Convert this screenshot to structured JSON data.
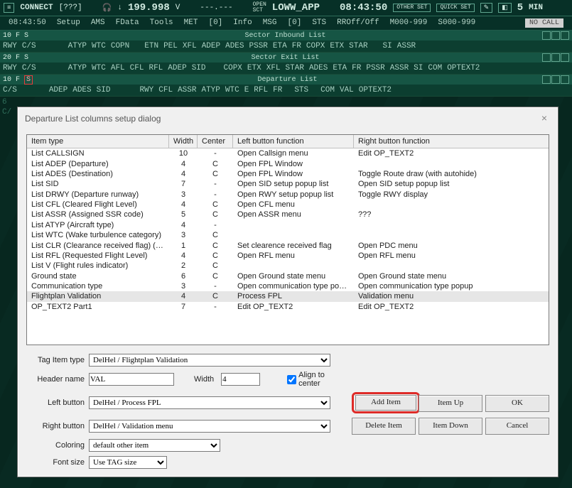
{
  "top": {
    "menu_word": "MENU",
    "connect": "CONNECT",
    "connect_state": "[???]",
    "headset": "🎧",
    "down_arrow": "↓",
    "freq": "199.998",
    "freq_v": "V",
    "dashes": "---.---",
    "open_lbl": "OPEN",
    "sct_lbl": "SCT",
    "sector": "LOWW_APP",
    "clock": "08:43:50",
    "other_set": "OTHER SET",
    "quick_set": "QUICK SET",
    "digit": "5",
    "min": "MIN"
  },
  "menubar": {
    "time": "08:43:50",
    "items": [
      "Setup",
      "AMS",
      "FData",
      "Tools",
      "MET",
      "[0]",
      "Info",
      "MSG",
      "[0]",
      "STS",
      "RROff/Off",
      "M000-999",
      "S000-999"
    ],
    "nocall": "NO CALL"
  },
  "lists": {
    "inbound": {
      "tag": "10 F  S",
      "title": "Sector Inbound List",
      "cols": [
        "RWY",
        "C/S",
        "ATYP",
        "WTC",
        "COPN",
        "ETN",
        "PEL",
        "XFL",
        "ADEP",
        "ADES",
        "PSSR",
        "ETA",
        "FR",
        "COPX",
        "ETX",
        "STAR",
        "SI",
        "ASSR"
      ]
    },
    "exit": {
      "tag": "20 F  S",
      "title": "Sector Exit List",
      "cols": [
        "RWY",
        "C/S",
        "ATYP",
        "WTC",
        "AFL",
        "CFL",
        "RFL",
        "ADEP",
        "SID",
        "COPX",
        "ETX",
        "XFL",
        "STAR",
        "ADES",
        "ETA",
        "FR",
        "PSSR",
        "ASSR",
        "SI",
        "COM",
        "OPTEXT2"
      ]
    },
    "dep": {
      "tag": "10 F",
      "tag_s": "S",
      "title": "Departure List",
      "cols": [
        "C/S",
        "ADEP",
        "ADES",
        "SID",
        "RWY",
        "CFL",
        "ASSR",
        "ATYP",
        "WTC",
        "E",
        "RFL",
        "FR",
        "STS",
        "COM",
        "VAL",
        "OPTEXT2"
      ]
    }
  },
  "bg": {
    "label1": "6",
    "label2": "C/"
  },
  "dialog": {
    "title": "Departure List columns setup dialog",
    "headers": {
      "c0": "Item type",
      "c1": "Width",
      "c2": "Center",
      "c3": "Left button function",
      "c4": "Right button function"
    },
    "rows": [
      {
        "t": "List CALLSIGN",
        "w": "10",
        "c": "-",
        "l": "Open Callsign menu",
        "r": "Edit OP_TEXT2"
      },
      {
        "t": "List ADEP (Departure)",
        "w": "4",
        "c": "C",
        "l": "Open FPL Window",
        "r": ""
      },
      {
        "t": "List ADES (Destination)",
        "w": "4",
        "c": "C",
        "l": "Open FPL Window",
        "r": "Toggle Route draw (with autohide)"
      },
      {
        "t": "List SID",
        "w": "7",
        "c": "-",
        "l": "Open SID setup popup list",
        "r": "Open SID setup popup list"
      },
      {
        "t": "List DRWY (Departure runway)",
        "w": "3",
        "c": "-",
        "l": "Open RWY setup popup list",
        "r": "Toggle RWY display"
      },
      {
        "t": "List CFL (Cleared Flight Level)",
        "w": "4",
        "c": "C",
        "l": "Open CFL menu",
        "r": ""
      },
      {
        "t": "List ASSR (Assigned SSR code)",
        "w": "5",
        "c": "C",
        "l": "Open ASSR menu",
        "r": "???"
      },
      {
        "t": "List ATYP (Aircraft type)",
        "w": "4",
        "c": "-",
        "l": "",
        "r": ""
      },
      {
        "t": "List WTC (Wake turbulence category)",
        "w": "3",
        "c": "C",
        "l": "",
        "r": ""
      },
      {
        "t": "List CLR (Clearance received flag) (short)",
        "w": "1",
        "c": "C",
        "l": "Set clearence received flag",
        "r": "Open PDC menu"
      },
      {
        "t": "List RFL (Requested Flight Level)",
        "w": "4",
        "c": "C",
        "l": "Open RFL menu",
        "r": "Open RFL menu"
      },
      {
        "t": "List V (Flight rules indicator)",
        "w": "2",
        "c": "C",
        "l": "",
        "r": ""
      },
      {
        "t": "Ground state",
        "w": "6",
        "c": "C",
        "l": "Open Ground state menu",
        "r": "Open Ground state menu"
      },
      {
        "t": "Communication type",
        "w": "3",
        "c": "-",
        "l": "Open communication type popup",
        "r": "Open communication type popup"
      },
      {
        "t": "Flightplan Validation",
        "w": "4",
        "c": "C",
        "l": "Process FPL",
        "r": "Validation menu",
        "sel": true
      },
      {
        "t": "OP_TEXT2 Part1",
        "w": "7",
        "c": "-",
        "l": "Edit OP_TEXT2",
        "r": "Edit OP_TEXT2"
      }
    ],
    "form": {
      "tagitem_lbl": "Tag Item type",
      "tagitem_val": "DelHel / Flightplan Validation",
      "header_lbl": "Header name",
      "header_val": "VAL",
      "width_lbl": "Width",
      "width_val": "4",
      "align_lbl": "Align to center",
      "leftbtn_lbl": "Left button",
      "leftbtn_val": "DelHel / Process FPL",
      "rightbtn_lbl": "Right button",
      "rightbtn_val": "DelHel / Validation menu",
      "coloring_lbl": "Coloring",
      "coloring_val": "default other item",
      "fontsize_lbl": "Font size",
      "fontsize_val": "Use TAG size"
    },
    "buttons": {
      "add": "Add Item",
      "itemup": "Item Up",
      "ok": "OK",
      "del": "Delete Item",
      "itemdown": "Item Down",
      "cancel": "Cancel"
    }
  }
}
